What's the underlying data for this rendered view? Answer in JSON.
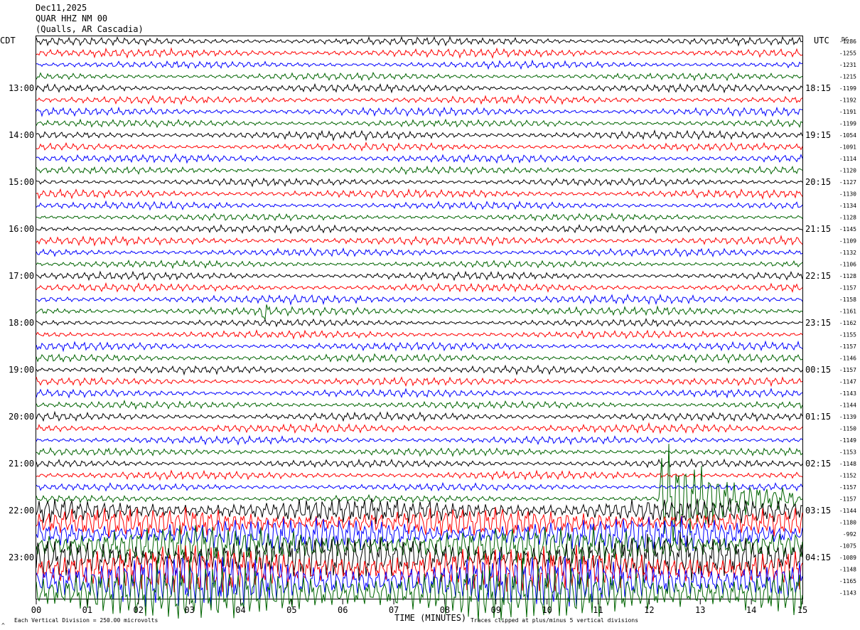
{
  "header": {
    "date": "Dec11,2025",
    "station": "QUAR HHZ NM 00",
    "location": "(Qualls, AR Cascadia)"
  },
  "left_axis_title": "CDT",
  "right_axis_title": "UTC",
  "dc_title": "DC",
  "footer": {
    "scale_note": "Each Vertical Division =  250.00 microvolts",
    "clip_note": "Traces clipped at plus/minus 5 vertical divisions",
    "corner_mark": "^"
  },
  "chart_data": {
    "type": "line",
    "xlabel": "TIME (MINUTES)",
    "xlim": [
      0,
      15
    ],
    "x_ticks": [
      "00",
      "01",
      "02",
      "03",
      "04",
      "05",
      "06",
      "07",
      "08",
      "09",
      "10",
      "11",
      "12",
      "13",
      "14",
      "15"
    ],
    "left_hour_labels": [
      {
        "label": "13:00",
        "row": 4
      },
      {
        "label": "14:00",
        "row": 8
      },
      {
        "label": "15:00",
        "row": 12
      },
      {
        "label": "16:00",
        "row": 16
      },
      {
        "label": "17:00",
        "row": 20
      },
      {
        "label": "18:00",
        "row": 24
      },
      {
        "label": "19:00",
        "row": 28
      },
      {
        "label": "20:00",
        "row": 32
      },
      {
        "label": "21:00",
        "row": 36
      },
      {
        "label": "22:00",
        "row": 40
      },
      {
        "label": "23:00",
        "row": 44
      }
    ],
    "right_hour_labels": [
      {
        "label": "18:15",
        "row": 4
      },
      {
        "label": "19:15",
        "row": 8
      },
      {
        "label": "20:15",
        "row": 12
      },
      {
        "label": "21:15",
        "row": 16
      },
      {
        "label": "22:15",
        "row": 20
      },
      {
        "label": "23:15",
        "row": 24
      },
      {
        "label": "00:15",
        "row": 28
      },
      {
        "label": "01:15",
        "row": 32
      },
      {
        "label": "02:15",
        "row": 36
      },
      {
        "label": "03:15",
        "row": 40
      },
      {
        "label": "04:15",
        "row": 44
      }
    ],
    "dc_offsets": [
      "-1286",
      "-1255",
      "-1231",
      "-1215",
      "-1199",
      "-1192",
      "-1191",
      "-1199",
      "-1054",
      "-1091",
      "-1114",
      "-1120",
      "-1127",
      "-1130",
      "-1134",
      "-1128",
      "-1145",
      "-1109",
      "-1132",
      "-1106",
      "-1128",
      "-1157",
      "-1158",
      "-1161",
      "-1162",
      "-1155",
      "-1157",
      "-1146",
      "-1157",
      "-1147",
      "-1143",
      "-1144",
      "-1139",
      "-1150",
      "-1149",
      "-1153",
      "-1148",
      "-1152",
      "-1157",
      "-1157",
      "-1144",
      "-1180",
      "-992",
      "-1075",
      "-1089",
      "-1148",
      "-1165",
      "-1143"
    ],
    "trace_colors": [
      "#000000",
      "#ff0000",
      "#0000ff",
      "#006400"
    ],
    "events": [
      {
        "row": 39,
        "start_min": 12.2,
        "end_min": 14.9,
        "amplitude_divisions": 5
      },
      {
        "row": 23,
        "start_min": 4.4,
        "end_min": 4.6,
        "amplitude_divisions": 2
      }
    ],
    "noisy_rows_from": 40
  }
}
